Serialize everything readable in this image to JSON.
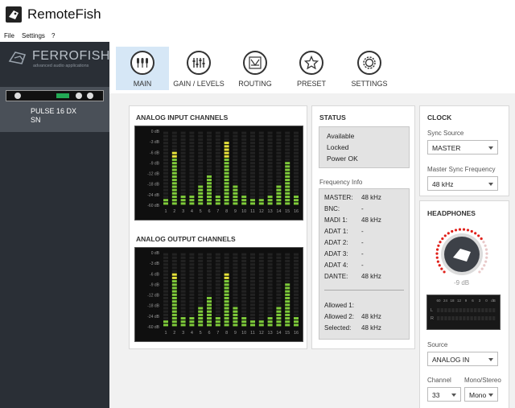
{
  "window": {
    "title": "RemoteFish"
  },
  "menu": [
    "File",
    "Settings",
    "?"
  ],
  "sidebar": {
    "brand": "FERROFISH",
    "tagline": "advanced audio applications",
    "device_name": "PULSE 16 DX",
    "device_sn": "SN"
  },
  "toolbar": [
    {
      "label": "MAIN",
      "icon": "mic-group-icon",
      "active": true
    },
    {
      "label": "GAIN / LEVELS",
      "icon": "faders-icon",
      "active": false
    },
    {
      "label": "ROUTING",
      "icon": "routing-icon",
      "active": false
    },
    {
      "label": "PRESET",
      "icon": "star-icon",
      "active": false
    },
    {
      "label": "SETTINGS",
      "icon": "gear-icon",
      "active": false
    }
  ],
  "analog_input": {
    "title": "ANALOG INPUT CHANNELS",
    "scale": [
      "0 dB",
      "-3 dB",
      "-6 dB",
      "-9 dB",
      "-12 dB",
      "-18 dB",
      "-24 dB",
      "-60 dB"
    ],
    "channels": [
      "1",
      "2",
      "3",
      "4",
      "5",
      "6",
      "7",
      "8",
      "9",
      "10",
      "11",
      "12",
      "13",
      "14",
      "15",
      "16"
    ],
    "levels_db": [
      -60,
      -6,
      -24,
      -24,
      -18,
      -12,
      -24,
      -3,
      -18,
      -24,
      -60,
      -60,
      -24,
      -18,
      -9,
      -24
    ]
  },
  "analog_output": {
    "title": "ANALOG OUTPUT CHANNELS",
    "scale": [
      "0 dB",
      "-3 dB",
      "-6 dB",
      "-9 dB",
      "-12 dB",
      "-18 dB",
      "-24 dB",
      "-60 dB"
    ],
    "channels": [
      "1",
      "2",
      "3",
      "4",
      "5",
      "6",
      "7",
      "8",
      "9",
      "10",
      "11",
      "12",
      "13",
      "14",
      "15",
      "16"
    ],
    "levels_db": [
      -60,
      -6,
      -24,
      -24,
      -18,
      -12,
      -24,
      -6,
      -18,
      -24,
      -60,
      -60,
      -24,
      -18,
      -9,
      -24
    ]
  },
  "status": {
    "title": "STATUS",
    "lines": [
      "Available",
      "Locked",
      "Power OK"
    ]
  },
  "frequency_info": {
    "title": "Frequency Info",
    "rows": [
      {
        "label": "MASTER:",
        "value": "48 kHz"
      },
      {
        "label": "BNC:",
        "value": "-"
      },
      {
        "label": "MADI 1:",
        "value": "48 kHz"
      },
      {
        "label": "ADAT 1:",
        "value": "-"
      },
      {
        "label": "ADAT 2:",
        "value": "-"
      },
      {
        "label": "ADAT 3:",
        "value": "-"
      },
      {
        "label": "ADAT 4:",
        "value": "-"
      },
      {
        "label": "DANTE:",
        "value": "48 kHz"
      }
    ],
    "allowed": [
      {
        "label": "Allowed 1:",
        "value": ""
      },
      {
        "label": "Allowed 2:",
        "value": "48 kHz"
      },
      {
        "label": "Selected:",
        "value": "48 kHz"
      }
    ]
  },
  "clock": {
    "title": "CLOCK",
    "sync_source_label": "Sync Source",
    "sync_source_value": "MASTER",
    "master_freq_label": "Master Sync Frequency",
    "master_freq_value": "48 kHz"
  },
  "headphones": {
    "title": "HEADPHONES",
    "volume_label": "-9 dB",
    "volume_fraction": 0.72,
    "meter_scale": [
      "60",
      "24",
      "18",
      "12",
      "9",
      "6",
      "3",
      "0",
      "dB"
    ],
    "meter_channels": [
      "L",
      "R"
    ],
    "source_label": "Source",
    "source_value": "ANALOG IN",
    "channel_label": "Channel",
    "channel_value": "33",
    "mono_label": "Mono/Stereo",
    "mono_value": "Mono"
  },
  "colors": {
    "meter_green": "#7ecb3a",
    "meter_yellow": "#e6e23a",
    "active_tab": "#d6e7f6",
    "sidebar": "#2a2f36"
  }
}
